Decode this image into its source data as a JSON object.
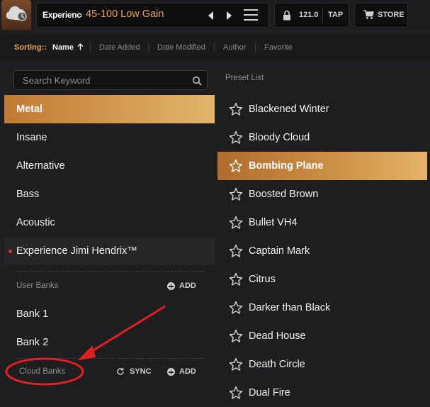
{
  "topbar": {
    "bank_label": "Experience Jimi Hendrix™",
    "preset_name": "45-100 Low Gain",
    "tempo": "121.0",
    "tap_label": "TAP",
    "store_label": "STORE"
  },
  "sorting": {
    "label": "Sorting::",
    "options": [
      "Name",
      "Date Added",
      "Date Modified",
      "Author",
      "Favorite"
    ],
    "active": "Name"
  },
  "left_panel": {
    "search_placeholder": "Search Keyword",
    "categories": [
      {
        "label": "Metal",
        "selected": true
      },
      {
        "label": "Insane"
      },
      {
        "label": "Alternative"
      },
      {
        "label": "Bass"
      },
      {
        "label": "Acoustic"
      },
      {
        "label": "Experience Jimi Hendrix™",
        "active_dot": true
      }
    ],
    "user_banks": {
      "title": "User Banks",
      "add_label": "ADD",
      "items": [
        "Bank 1",
        "Bank 2"
      ]
    },
    "cloud_banks": {
      "title": "Cloud Banks",
      "sync_label": "SYNC",
      "add_label": "ADD"
    }
  },
  "right_panel": {
    "title": "Preset List",
    "presets": [
      "Blackened Winter",
      "Bloody Cloud",
      "Bombing Plane",
      "Boosted Brown",
      "Bullet VH4",
      "Captain Mark",
      "Citrus",
      "Darker than Black",
      "Dead House",
      "Death Circle",
      "Dual Fire"
    ],
    "selected": "Bombing Plane"
  },
  "colors": {
    "accent": "#e8a45c",
    "selection_gradient_start": "#c07a32",
    "selection_gradient_end": "#e0b66c",
    "annotation": "#e02020"
  }
}
